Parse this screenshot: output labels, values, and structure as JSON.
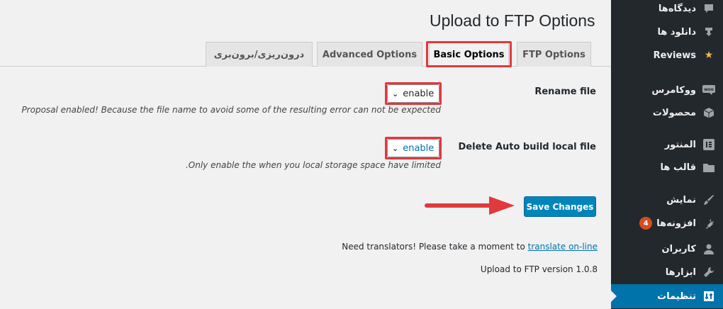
{
  "page": {
    "title": "Upload to FTP Options"
  },
  "tabs": [
    {
      "label": "درون‌ریزی/برون‌بری"
    },
    {
      "label": "Advanced Options"
    },
    {
      "label": "Basic Options"
    },
    {
      "label": "FTP Options"
    }
  ],
  "settings": {
    "rename_file": {
      "label": "Rename file",
      "value": "enable",
      "description": "Proposal enabled! Because the file name to avoid some of the resulting error can not be expected"
    },
    "delete_local": {
      "label": "Delete Auto build local file",
      "value": "enable",
      "description": ".Only enable the when you local storage space have limited"
    }
  },
  "save_button": {
    "label": "Save Changes"
  },
  "footer": {
    "translators_text": "Need translators! Please take a moment to",
    "translate_link": "translate on-line",
    "version": "Upload to FTP version 1.0.8"
  },
  "sidebar": {
    "items": [
      {
        "label": "دیدگاه‌ها",
        "icon": "comment-icon"
      },
      {
        "label": "دانلود ها",
        "icon": "download-icon"
      },
      {
        "label": "Reviews",
        "icon": "star-icon"
      },
      {
        "label": "ووکامرس",
        "icon": "woo-icon"
      },
      {
        "label": "محصولات",
        "icon": "box-icon"
      },
      {
        "label": "المنتور",
        "icon": "elementor-icon"
      },
      {
        "label": "قالب ها",
        "icon": "folder-icon"
      },
      {
        "label": "نمایش",
        "icon": "brush-icon"
      },
      {
        "label": "افزونه‌ها",
        "icon": "plugin-icon",
        "badge": "4"
      },
      {
        "label": "کاربران",
        "icon": "user-icon"
      },
      {
        "label": "ابزارها",
        "icon": "wrench-icon"
      },
      {
        "label": "تنظیمات",
        "icon": "settings-icon"
      }
    ]
  },
  "colors": {
    "accent": "#0085ba",
    "highlight": "#e0393e",
    "sidebar": "#23282d",
    "active": "#0073aa"
  }
}
